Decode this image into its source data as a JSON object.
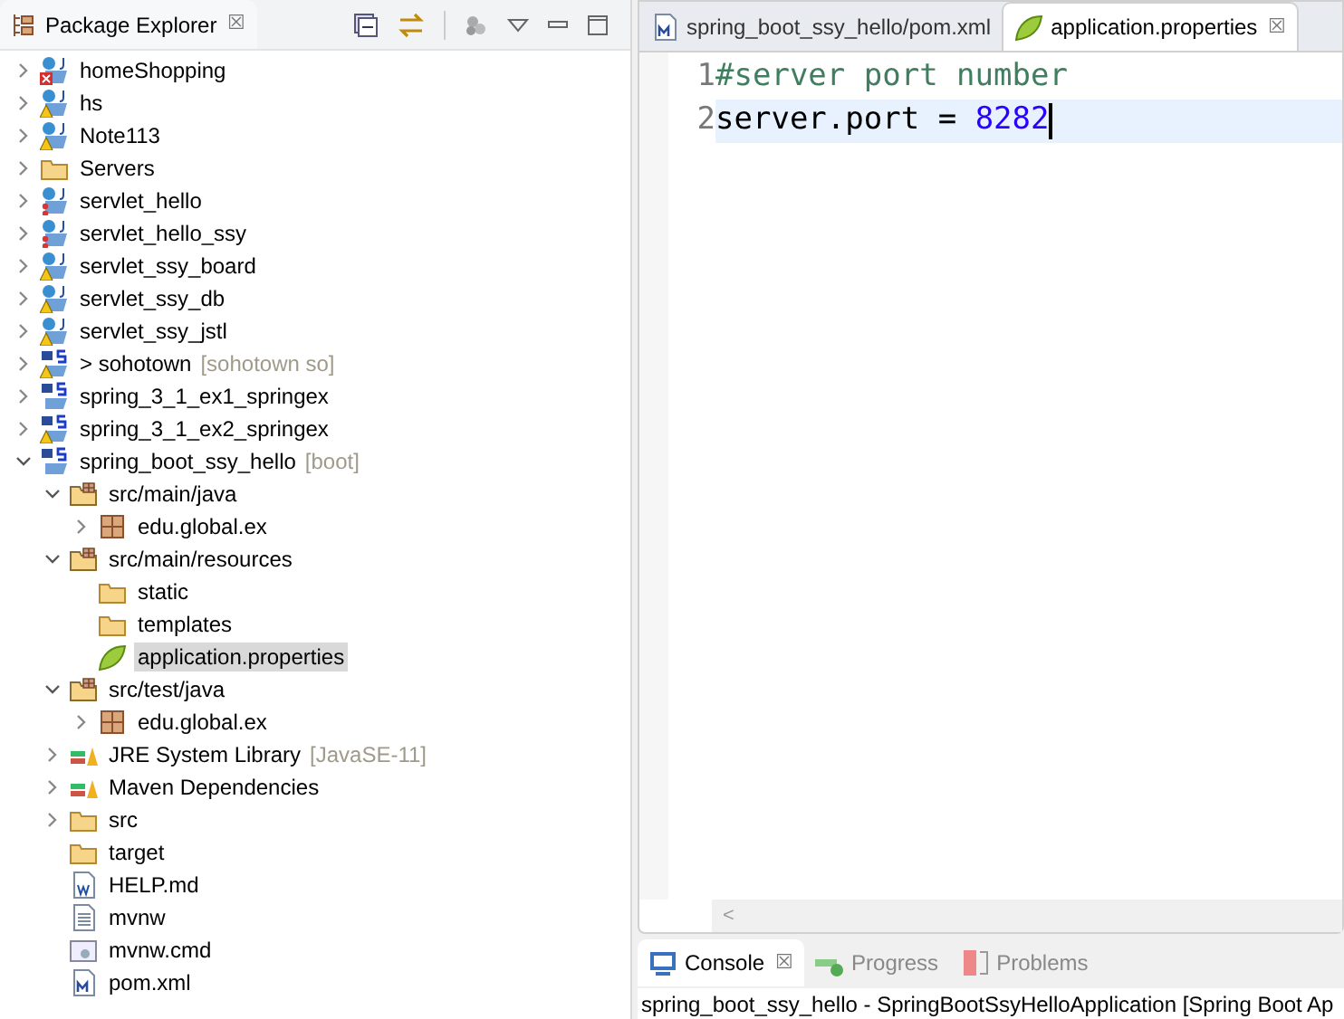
{
  "explorer": {
    "title": "Package Explorer",
    "close": "☒",
    "tree": [
      {
        "label": "homeShopping",
        "kind": "project-error",
        "expanded": false,
        "selected": false
      },
      {
        "label": "hs",
        "kind": "project-warning",
        "expanded": false,
        "selected": false
      },
      {
        "label": "Note113",
        "kind": "project-warning",
        "expanded": false,
        "selected": false
      },
      {
        "label": "Servers",
        "kind": "folder",
        "expanded": false,
        "selected": false
      },
      {
        "label": "servlet_hello",
        "kind": "project-breakpoint",
        "expanded": false,
        "selected": false
      },
      {
        "label": "servlet_hello_ssy",
        "kind": "project-breakpoint",
        "expanded": false,
        "selected": false
      },
      {
        "label": "servlet_ssy_board",
        "kind": "project-warning",
        "expanded": false,
        "selected": false
      },
      {
        "label": "servlet_ssy_db",
        "kind": "project-warning",
        "expanded": false,
        "selected": false
      },
      {
        "label": "servlet_ssy_jstl",
        "kind": "project-warning",
        "expanded": false,
        "selected": false
      },
      {
        "label": "> sohotown",
        "decoration": "[sohotown so]",
        "kind": "maven-project-warning",
        "expanded": false,
        "selected": false
      },
      {
        "label": "spring_3_1_ex1_springex",
        "kind": "maven-project",
        "expanded": false,
        "selected": false
      },
      {
        "label": "spring_3_1_ex2_springex",
        "kind": "maven-project-warning",
        "expanded": false,
        "selected": false
      },
      {
        "label": "spring_boot_ssy_hello",
        "decoration": "[boot]",
        "kind": "maven-project",
        "expanded": true,
        "selected": false,
        "children": [
          {
            "label": "src/main/java",
            "kind": "source-folder",
            "expanded": true,
            "selected": false,
            "children": [
              {
                "label": "edu.global.ex",
                "kind": "package",
                "expanded": false,
                "selected": false
              }
            ]
          },
          {
            "label": "src/main/resources",
            "kind": "source-folder",
            "expanded": true,
            "selected": false,
            "children": [
              {
                "label": "static",
                "kind": "folder",
                "selected": false
              },
              {
                "label": "templates",
                "kind": "folder",
                "selected": false
              },
              {
                "label": "application.properties",
                "kind": "leaf-file",
                "selected": true
              }
            ]
          },
          {
            "label": "src/test/java",
            "kind": "source-folder",
            "expanded": true,
            "selected": false,
            "children": [
              {
                "label": "edu.global.ex",
                "kind": "package",
                "expanded": false,
                "selected": false
              }
            ]
          },
          {
            "label": "JRE System Library",
            "decoration": "[JavaSE-11]",
            "kind": "library",
            "expanded": false,
            "selected": false
          },
          {
            "label": "Maven Dependencies",
            "kind": "library",
            "expanded": false,
            "selected": false
          },
          {
            "label": "src",
            "kind": "folder",
            "expanded": false,
            "selected": false
          },
          {
            "label": "target",
            "kind": "folder",
            "selected": false
          },
          {
            "label": "HELP.md",
            "kind": "word-file",
            "selected": false
          },
          {
            "label": "mvnw",
            "kind": "text-file",
            "selected": false
          },
          {
            "label": "mvnw.cmd",
            "kind": "cmd-file",
            "selected": false
          },
          {
            "label": "pom.xml",
            "kind": "maven-file",
            "selected": false
          }
        ]
      }
    ]
  },
  "editor": {
    "tabs": [
      {
        "label": "spring_boot_ssy_hello/pom.xml",
        "kind": "maven-file",
        "selected": false
      },
      {
        "label": "application.properties",
        "kind": "leaf-file",
        "selected": true,
        "close": "☒"
      }
    ],
    "lines": [
      {
        "number": "1",
        "current": false,
        "parts": [
          {
            "text": "#server port number",
            "kind": "comment"
          }
        ]
      },
      {
        "number": "2",
        "current": true,
        "parts": [
          {
            "text": "server.port",
            "kind": "key"
          },
          {
            "text": " = ",
            "kind": "operator"
          },
          {
            "text": "8282",
            "kind": "number"
          }
        ]
      }
    ],
    "scroll_left": "<"
  },
  "console": {
    "tabs": [
      {
        "label": "Console",
        "kind": "console",
        "selected": true,
        "close": "☒"
      },
      {
        "label": "Progress",
        "kind": "progress",
        "selected": false
      },
      {
        "label": "Problems",
        "kind": "problems",
        "selected": false
      }
    ],
    "text": "spring_boot_ssy_hello - SpringBootSsyHelloApplication [Spring Boot Ap"
  }
}
